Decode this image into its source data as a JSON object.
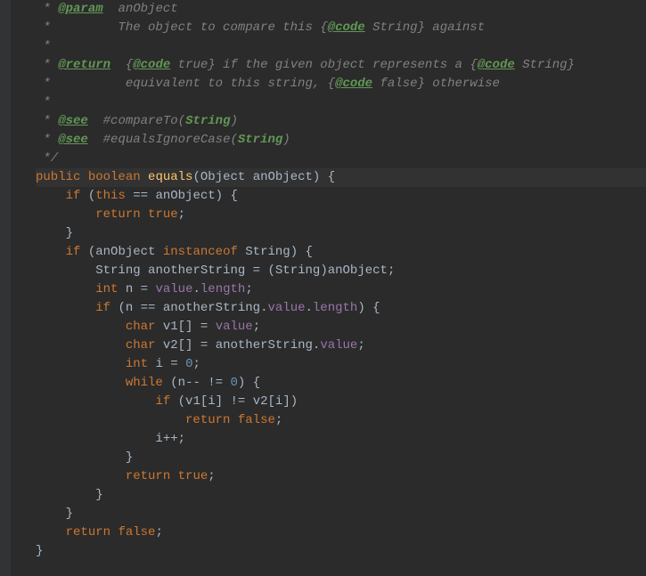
{
  "doc": {
    "param_tag": "@param",
    "param_name": "anObject",
    "param_desc1": "The object to compare this {",
    "code_tag1": "@code",
    "param_desc2": " String} against",
    "return_tag": "@return",
    "return_desc1": "{",
    "code_tag2": "@code",
    "return_desc2": " true} if the given object represents a {",
    "code_tag3": "@code",
    "return_desc3": " String}",
    "return_desc4": "equivalent to this string, {",
    "code_tag4": "@code",
    "return_desc5": " false} otherwise",
    "see_tag1": "@see",
    "see_ref1a": "#compareTo(",
    "see_ref1b": "String",
    "see_ref1c": ")",
    "see_tag2": "@see",
    "see_ref2a": "#equalsIgnoreCase(",
    "see_ref2b": "String",
    "see_ref2c": ")",
    "close": "*/"
  },
  "sig": {
    "public": "public",
    "boolean": "boolean",
    "method": "equals",
    "ptype": "Object",
    "pname": "anObject"
  },
  "body": {
    "if1": "if",
    "this": "this",
    "anObject": "anObject",
    "return1": "return",
    "true1": "true",
    "if2": "if",
    "instanceof": "instanceof",
    "String": "String",
    "anotherString": "anotherString",
    "int": "int",
    "n": "n",
    "value": "value",
    "length": "length",
    "if3": "if",
    "char": "char",
    "v1": "v1",
    "v2": "v2",
    "i": "i",
    "zero": "0",
    "while": "while",
    "if4": "if",
    "return2": "return",
    "false1": "false",
    "ipp": "i++;",
    "return3": "return",
    "true2": "true",
    "return4": "return",
    "false2": "false"
  }
}
